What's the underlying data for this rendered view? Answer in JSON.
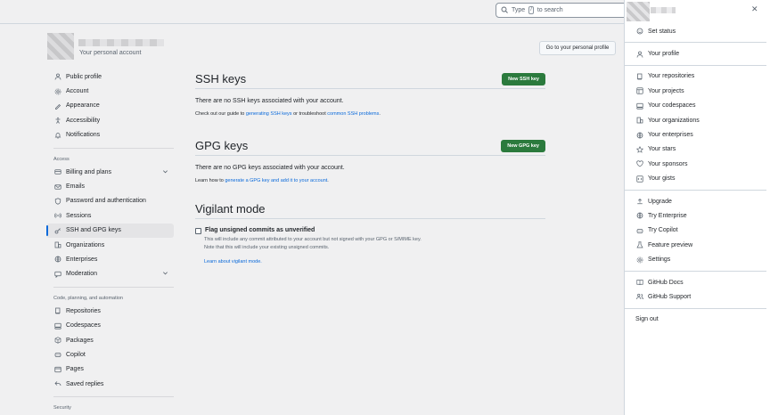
{
  "search": {
    "prefix": "Type",
    "key": "/",
    "suffix": "to search"
  },
  "account": {
    "subtitle": "Your personal account",
    "goto_label": "Go to your personal profile"
  },
  "sidebar": {
    "top": [
      {
        "label": "Public profile",
        "icon": "person-icon"
      },
      {
        "label": "Account",
        "icon": "gear-icon"
      },
      {
        "label": "Appearance",
        "icon": "paintbrush-icon"
      },
      {
        "label": "Accessibility",
        "icon": "accessibility-icon"
      },
      {
        "label": "Notifications",
        "icon": "bell-icon"
      }
    ],
    "access_title": "Access",
    "access": [
      {
        "label": "Billing and plans",
        "icon": "credit-card-icon",
        "chevron": true
      },
      {
        "label": "Emails",
        "icon": "mail-icon"
      },
      {
        "label": "Password and authentication",
        "icon": "shield-lock-icon"
      },
      {
        "label": "Sessions",
        "icon": "broadcast-icon"
      },
      {
        "label": "SSH and GPG keys",
        "icon": "key-icon",
        "active": true
      },
      {
        "label": "Organizations",
        "icon": "organization-icon"
      },
      {
        "label": "Enterprises",
        "icon": "globe-icon"
      },
      {
        "label": "Moderation",
        "icon": "report-icon",
        "chevron": true
      }
    ],
    "code_title": "Code, planning, and automation",
    "code": [
      {
        "label": "Repositories",
        "icon": "repo-icon"
      },
      {
        "label": "Codespaces",
        "icon": "codespaces-icon"
      },
      {
        "label": "Packages",
        "icon": "package-icon"
      },
      {
        "label": "Copilot",
        "icon": "copilot-icon"
      },
      {
        "label": "Pages",
        "icon": "browser-icon"
      },
      {
        "label": "Saved replies",
        "icon": "reply-icon"
      }
    ],
    "security_title": "Security"
  },
  "ssh": {
    "title": "SSH keys",
    "button": "New SSH key",
    "empty": "There are no SSH keys associated with your account.",
    "help_prefix": "Check out our guide to ",
    "help_link1": "generating SSH keys",
    "help_mid": " or troubleshoot ",
    "help_link2": "common SSH problems",
    "help_suffix": "."
  },
  "gpg": {
    "title": "GPG keys",
    "button": "New GPG key",
    "empty": "There are no GPG keys associated with your account.",
    "help_prefix": "Learn how to ",
    "help_link": "generate a GPG key and add it to your account",
    "help_suffix": "."
  },
  "vigilant": {
    "title": "Vigilant mode",
    "checkbox_label": "Flag unsigned commits as unverified",
    "desc1": "This will include any commit attributed to your account but not signed with your GPG or S/MIME key.",
    "desc2": "Note that this will include your existing unsigned commits.",
    "link": "Learn about vigilant mode."
  },
  "menu": {
    "groups": [
      [
        {
          "label": "Set status",
          "icon": "smiley-icon"
        }
      ],
      [
        {
          "label": "Your profile",
          "icon": "person-icon"
        }
      ],
      [
        {
          "label": "Your repositories",
          "icon": "repo-icon"
        },
        {
          "label": "Your projects",
          "icon": "table-icon"
        },
        {
          "label": "Your codespaces",
          "icon": "codespaces-icon"
        },
        {
          "label": "Your organizations",
          "icon": "organization-icon"
        },
        {
          "label": "Your enterprises",
          "icon": "globe-icon"
        },
        {
          "label": "Your stars",
          "icon": "star-icon"
        },
        {
          "label": "Your sponsors",
          "icon": "heart-icon"
        },
        {
          "label": "Your gists",
          "icon": "code-square-icon"
        }
      ],
      [
        {
          "label": "Upgrade",
          "icon": "upload-icon"
        },
        {
          "label": "Try Enterprise",
          "icon": "globe-icon"
        },
        {
          "label": "Try Copilot",
          "icon": "copilot-icon"
        },
        {
          "label": "Feature preview",
          "icon": "beaker-icon"
        },
        {
          "label": "Settings",
          "icon": "gear-icon"
        }
      ],
      [
        {
          "label": "GitHub Docs",
          "icon": "book-icon"
        },
        {
          "label": "GitHub Support",
          "icon": "people-icon"
        }
      ]
    ],
    "sign_out": "Sign out"
  },
  "colors": {
    "accent": "#0969da",
    "green": "#2b7a3d"
  }
}
